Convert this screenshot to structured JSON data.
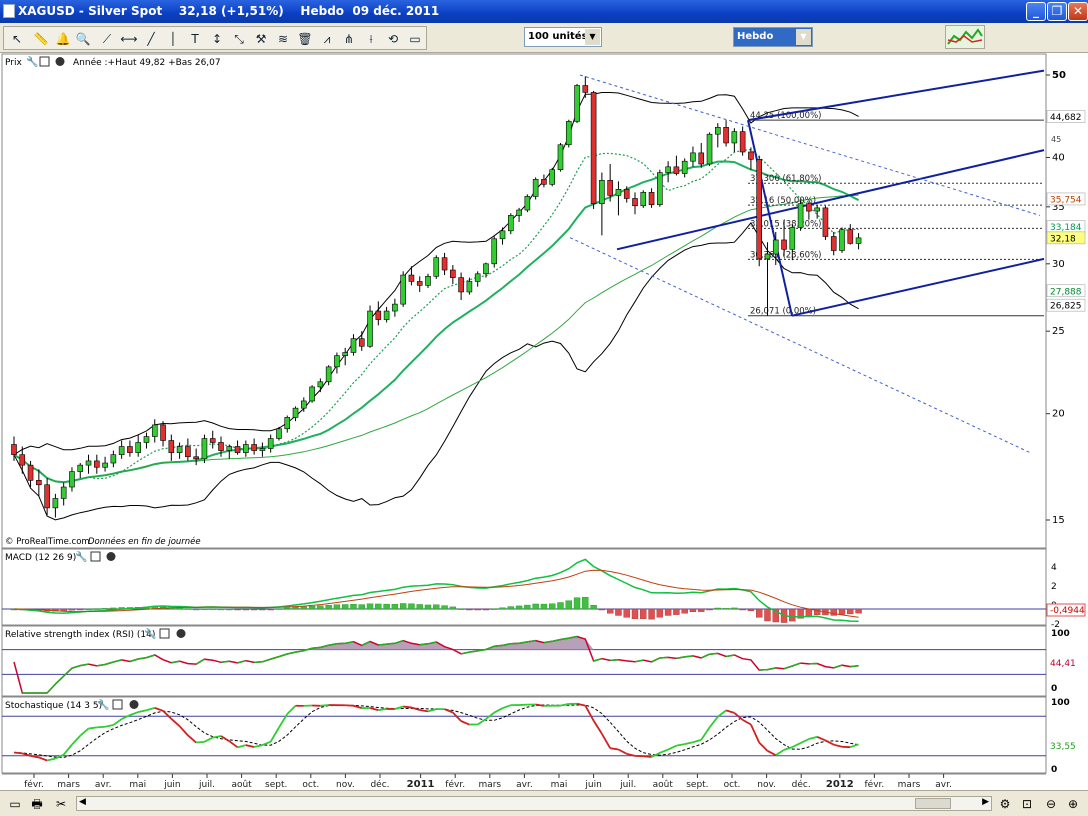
{
  "window": {
    "title": "XAGUSD - Silver Spot    32,18 (+1,51%)    Hebdo  09 déc. 2011",
    "controls": [
      "_",
      "❐",
      "✕"
    ]
  },
  "toolbar": {
    "units_select": "100 unités",
    "period_select": "Hebdo"
  },
  "price_panel": {
    "title": "Prix",
    "range_label": "Année :+Haut 49,82 +Bas 26,07",
    "footer_brand": "© ProRealTime.com",
    "footer_note": "Données en fin de journée",
    "y_ticks": [
      "50",
      "40",
      "35",
      "30",
      "25",
      "20",
      "15"
    ],
    "y_tick_values": [
      50,
      40,
      35,
      30,
      25,
      20,
      15
    ],
    "axis_tick_partial": "45",
    "price_tags": [
      {
        "text": "44,682",
        "value": 44.682,
        "bg": "#ffffff",
        "fg": "#000000"
      },
      {
        "text": "35,754",
        "value": 35.754,
        "bg": "#ffffff",
        "fg": "#c04000"
      },
      {
        "text": "33,184",
        "value": 33.184,
        "bg": "#ffffff",
        "fg": "#009a50"
      },
      {
        "text": "32,18",
        "value": 32.18,
        "bg": "#ffff80",
        "fg": "#000000"
      },
      {
        "text": "27,888",
        "value": 27.888,
        "bg": "#ffffff",
        "fg": "#008a30"
      },
      {
        "text": "26,825",
        "value": 26.825,
        "bg": "#ffffff",
        "fg": "#000000"
      }
    ],
    "fib_levels": [
      {
        "text": "44,25 (100,00%)",
        "value": 44.25
      },
      {
        "text": "37,306 (61,80%)",
        "value": 37.306
      },
      {
        "text": "35,16 (50,00%)",
        "value": 35.16
      },
      {
        "text": "33,015 (38,20%)",
        "value": 33.015
      },
      {
        "text": "30,361 (23,60%)",
        "value": 30.361
      },
      {
        "text": "26,071 (0,00%)",
        "value": 26.071
      }
    ]
  },
  "macd_panel": {
    "title": "MACD (12 26 9)",
    "y_ticks": [
      "4",
      "2",
      "0",
      "-2"
    ],
    "value_tag": "-0,4944"
  },
  "rsi_panel": {
    "title": "Relative strength index (RSI) (14)",
    "y_ticks": [
      "100",
      "0"
    ],
    "value_tag": "44,41"
  },
  "stoch_panel": {
    "title": "Stochastique (14 3 5)",
    "y_ticks": [
      "100",
      "0"
    ],
    "value_tag": "33,55"
  },
  "time_axis": {
    "labels": [
      "févr.",
      "mars",
      "avr.",
      "mai",
      "juin",
      "juil.",
      "août",
      "sept.",
      "oct.",
      "nov.",
      "déc.",
      "2011",
      "févr.",
      "mars",
      "avr.",
      "mai",
      "juin",
      "juil.",
      "août",
      "sept.",
      "oct.",
      "nov.",
      "déc.",
      "2012",
      "févr.",
      "mars",
      "avr."
    ],
    "bold_labels": [
      "2011",
      "2012"
    ]
  },
  "colors": {
    "bull": "#33cc33",
    "bear": "#e03030",
    "ma_green": "#20b060",
    "bollinger": "#000000",
    "channel": "#1020a0",
    "macd_hist_pos": "#40c040",
    "macd_hist_neg": "#e05050",
    "rsi_line": "#d00030",
    "stoch_k": "#30cc30"
  },
  "chart_data": {
    "type": "candlestick",
    "series_name": "XAGUSD",
    "ohlc": [
      [
        18.4,
        18.8,
        17.6,
        17.9
      ],
      [
        17.9,
        18.3,
        17.0,
        17.4
      ],
      [
        17.4,
        17.6,
        16.4,
        16.7
      ],
      [
        16.7,
        17.2,
        16.0,
        16.5
      ],
      [
        16.5,
        16.8,
        15.2,
        15.5
      ],
      [
        15.5,
        16.1,
        15.1,
        15.9
      ],
      [
        15.9,
        16.6,
        15.6,
        16.4
      ],
      [
        16.4,
        17.3,
        16.2,
        17.1
      ],
      [
        17.1,
        17.5,
        16.8,
        17.4
      ],
      [
        17.4,
        17.9,
        17.0,
        17.6
      ],
      [
        17.6,
        17.9,
        17.0,
        17.3
      ],
      [
        17.3,
        17.8,
        17.1,
        17.5
      ],
      [
        17.5,
        18.1,
        17.3,
        17.9
      ],
      [
        17.9,
        18.6,
        17.7,
        18.3
      ],
      [
        18.3,
        18.6,
        17.8,
        18.0
      ],
      [
        18.0,
        18.9,
        17.8,
        18.5
      ],
      [
        18.5,
        19.0,
        18.2,
        18.8
      ],
      [
        18.8,
        19.7,
        18.5,
        19.4
      ],
      [
        19.4,
        19.6,
        18.3,
        18.6
      ],
      [
        18.6,
        18.9,
        17.6,
        18.0
      ],
      [
        18.0,
        18.5,
        17.7,
        18.3
      ],
      [
        18.3,
        18.7,
        17.6,
        17.8
      ],
      [
        17.8,
        18.2,
        17.4,
        17.7
      ],
      [
        17.7,
        18.9,
        17.5,
        18.7
      ],
      [
        18.7,
        19.1,
        18.2,
        18.5
      ],
      [
        18.5,
        18.8,
        17.8,
        18.1
      ],
      [
        18.1,
        18.4,
        17.7,
        18.3
      ],
      [
        18.3,
        18.6,
        17.9,
        18.0
      ],
      [
        18.0,
        18.6,
        17.8,
        18.4
      ],
      [
        18.4,
        18.7,
        17.9,
        18.1
      ],
      [
        18.1,
        18.5,
        17.8,
        18.2
      ],
      [
        18.2,
        18.9,
        18.0,
        18.7
      ],
      [
        18.7,
        19.3,
        18.6,
        19.2
      ],
      [
        19.2,
        19.9,
        19.0,
        19.8
      ],
      [
        19.8,
        20.4,
        19.6,
        20.3
      ],
      [
        20.3,
        20.9,
        20.1,
        20.7
      ],
      [
        20.7,
        21.6,
        20.6,
        21.5
      ],
      [
        21.5,
        22.0,
        21.2,
        21.8
      ],
      [
        21.8,
        22.8,
        21.6,
        22.7
      ],
      [
        22.7,
        23.6,
        22.3,
        23.4
      ],
      [
        23.4,
        23.9,
        22.8,
        23.6
      ],
      [
        23.6,
        24.8,
        23.4,
        24.5
      ],
      [
        24.5,
        25.0,
        23.7,
        24.0
      ],
      [
        24.0,
        26.8,
        23.9,
        26.4
      ],
      [
        26.4,
        27.1,
        25.4,
        25.8
      ],
      [
        25.8,
        26.7,
        25.6,
        26.4
      ],
      [
        26.4,
        27.3,
        26.0,
        26.9
      ],
      [
        26.9,
        29.4,
        26.7,
        29.1
      ],
      [
        29.1,
        29.8,
        28.3,
        28.6
      ],
      [
        28.6,
        29.0,
        27.8,
        28.3
      ],
      [
        28.3,
        29.2,
        28.1,
        29.0
      ],
      [
        29.0,
        30.7,
        28.8,
        30.5
      ],
      [
        30.5,
        30.9,
        29.1,
        29.5
      ],
      [
        29.5,
        29.9,
        28.4,
        28.9
      ],
      [
        28.9,
        29.3,
        27.2,
        27.8
      ],
      [
        27.8,
        28.9,
        27.6,
        28.6
      ],
      [
        28.6,
        29.4,
        28.2,
        29.2
      ],
      [
        29.2,
        30.1,
        28.9,
        30.0
      ],
      [
        30.0,
        32.3,
        29.7,
        32.1
      ],
      [
        32.1,
        33.1,
        31.6,
        32.8
      ],
      [
        32.8,
        34.4,
        32.5,
        34.2
      ],
      [
        34.2,
        34.9,
        33.6,
        34.7
      ],
      [
        34.7,
        36.2,
        34.5,
        36.0
      ],
      [
        36.0,
        37.9,
        35.7,
        37.7
      ],
      [
        37.7,
        38.2,
        36.9,
        37.2
      ],
      [
        37.2,
        38.9,
        37.0,
        38.7
      ],
      [
        38.7,
        41.6,
        38.5,
        41.4
      ],
      [
        41.4,
        44.3,
        41.1,
        44.1
      ],
      [
        44.1,
        48.8,
        43.9,
        48.6
      ],
      [
        48.6,
        49.82,
        47.0,
        47.7
      ],
      [
        47.7,
        47.9,
        34.8,
        35.3
      ],
      [
        35.3,
        38.4,
        32.4,
        37.6
      ],
      [
        37.6,
        39.3,
        35.5,
        36.1
      ],
      [
        36.1,
        37.5,
        34.2,
        36.7
      ],
      [
        36.7,
        37.0,
        35.4,
        35.8
      ],
      [
        35.8,
        36.4,
        34.3,
        35.1
      ],
      [
        35.1,
        36.6,
        34.9,
        36.4
      ],
      [
        36.4,
        36.8,
        34.9,
        35.2
      ],
      [
        35.2,
        38.7,
        35.0,
        38.4
      ],
      [
        38.4,
        39.6,
        37.4,
        39.0
      ],
      [
        39.0,
        40.2,
        38.1,
        38.3
      ],
      [
        38.3,
        39.9,
        37.9,
        39.6
      ],
      [
        39.6,
        41.2,
        39.0,
        40.5
      ],
      [
        40.5,
        41.6,
        38.9,
        39.3
      ],
      [
        39.3,
        42.8,
        39.1,
        42.6
      ],
      [
        42.6,
        43.9,
        41.1,
        43.4
      ],
      [
        43.4,
        44.25,
        41.2,
        41.6
      ],
      [
        41.6,
        43.3,
        40.6,
        42.9
      ],
      [
        42.9,
        43.5,
        40.2,
        40.6
      ],
      [
        40.6,
        41.1,
        38.7,
        39.8
      ],
      [
        39.8,
        40.2,
        29.8,
        30.4
      ],
      [
        30.4,
        31.8,
        26.07,
        30.8
      ],
      [
        30.8,
        32.7,
        29.9,
        32.0
      ],
      [
        32.0,
        33.8,
        30.6,
        31.2
      ],
      [
        31.2,
        33.4,
        30.3,
        33.1
      ],
      [
        33.1,
        35.6,
        32.8,
        35.3
      ],
      [
        35.3,
        35.5,
        33.8,
        34.6
      ],
      [
        34.6,
        35.2,
        33.9,
        34.9
      ],
      [
        34.9,
        35.1,
        32.0,
        32.3
      ],
      [
        32.3,
        32.7,
        30.7,
        31.1
      ],
      [
        31.1,
        33.1,
        30.9,
        32.9
      ],
      [
        32.9,
        33.4,
        31.6,
        31.7
      ],
      [
        31.7,
        32.6,
        31.2,
        32.18
      ]
    ],
    "ylim": [
      13.5,
      52
    ],
    "grid": false
  }
}
